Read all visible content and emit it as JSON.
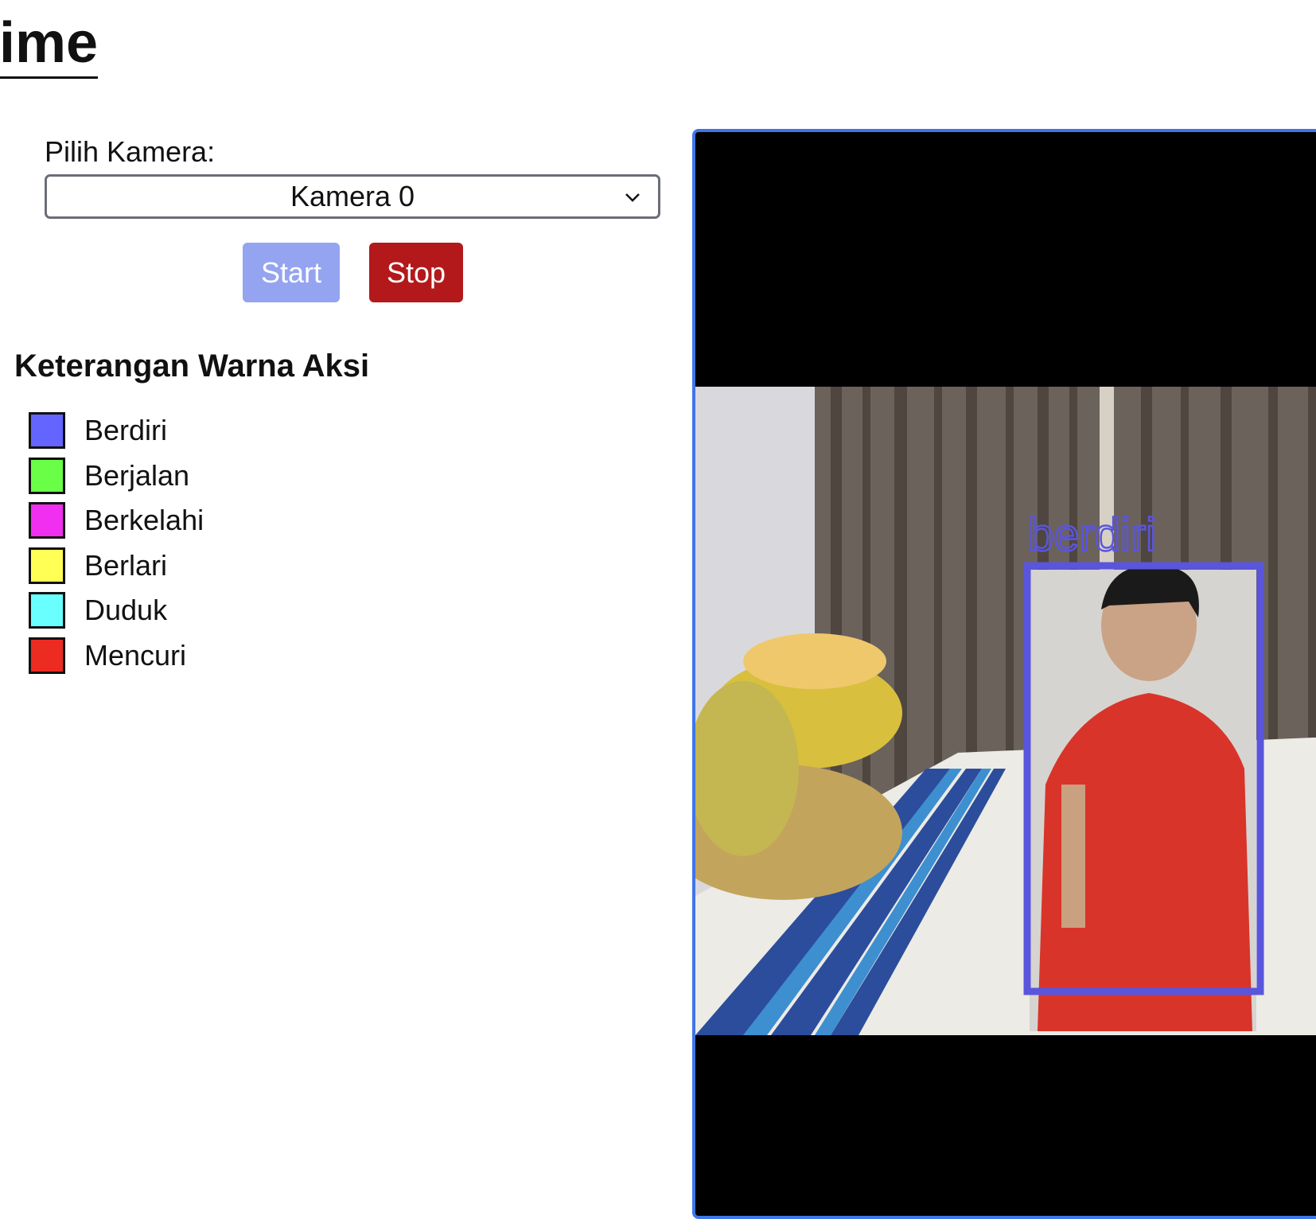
{
  "page": {
    "heading": "ime"
  },
  "camera": {
    "label": "Pilih Kamera:",
    "selected": "Kamera 0"
  },
  "controls": {
    "start_label": "Start",
    "stop_label": "Stop",
    "start_color": "#94a4f0",
    "stop_color": "#b3191b"
  },
  "legend": {
    "title": "Keterangan Warna Aksi",
    "items": [
      {
        "label": "Berdiri",
        "color": "#6464ff"
      },
      {
        "label": "Berjalan",
        "color": "#6aff47"
      },
      {
        "label": "Berkelahi",
        "color": "#f02ff0"
      },
      {
        "label": "Berlari",
        "color": "#ffff55"
      },
      {
        "label": "Duduk",
        "color": "#6affff"
      },
      {
        "label": "Mencuri",
        "color": "#ec2c22"
      }
    ]
  },
  "video": {
    "detection_label": "berdiri",
    "detection_color": "#5a55dd"
  }
}
